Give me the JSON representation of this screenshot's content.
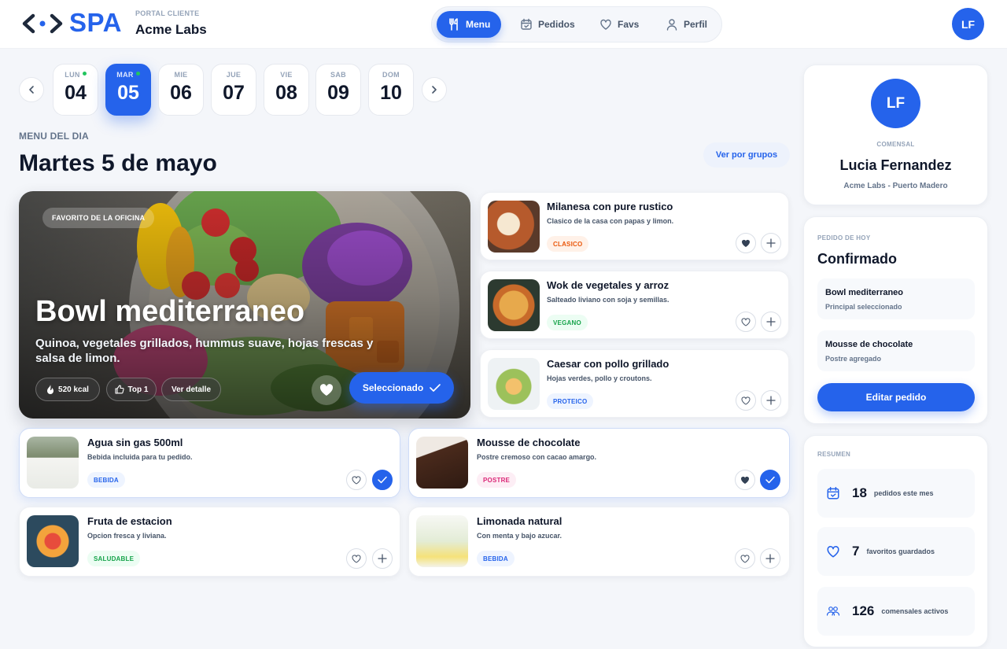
{
  "app": {
    "logo_text": "SPA",
    "portal_label": "PORTAL CLIENTE",
    "company": "Acme Labs",
    "user_initials": "LF"
  },
  "nav": [
    {
      "label": "Menu",
      "icon": "fork-knife-icon",
      "active": true
    },
    {
      "label": "Pedidos",
      "icon": "calendar-check-icon",
      "active": false
    },
    {
      "label": "Favs",
      "icon": "heart-icon",
      "active": false
    },
    {
      "label": "Perfil",
      "icon": "user-icon",
      "active": false
    }
  ],
  "days": [
    {
      "name": "LUN",
      "num": "04",
      "dot": true,
      "selected": false
    },
    {
      "name": "MAR",
      "num": "05",
      "dot": true,
      "selected": true
    },
    {
      "name": "MIE",
      "num": "06",
      "dot": false,
      "selected": false
    },
    {
      "name": "JUE",
      "num": "07",
      "dot": false,
      "selected": false
    },
    {
      "name": "VIE",
      "num": "08",
      "dot": false,
      "selected": false
    },
    {
      "name": "SAB",
      "num": "09",
      "dot": false,
      "selected": false
    },
    {
      "name": "DOM",
      "num": "10",
      "dot": false,
      "selected": false
    }
  ],
  "menu": {
    "section_label": "MENU DEL DIA",
    "title": "Martes 5 de mayo",
    "group_button": "Ver por grupos"
  },
  "hero": {
    "badge": "FAVORITO DE LA OFICINA",
    "title": "Bowl mediterraneo",
    "description": "Quinoa, vegetales grillados, hummus suave, hojas frescas y salsa de limon.",
    "kcal": "520 kcal",
    "rank": "Top 1",
    "detail": "Ver detalle",
    "selected_label": "Seleccionado"
  },
  "side_dishes": [
    {
      "name": "Milanesa con pure rustico",
      "desc": "Clasico de la casa con papas y limon.",
      "tag": "CLASICO",
      "tag_color": "orange",
      "fav": true
    },
    {
      "name": "Wok de vegetales y arroz",
      "desc": "Salteado liviano con soja y semillas.",
      "tag": "VEGANO",
      "tag_color": "green",
      "fav": false
    },
    {
      "name": "Caesar con pollo grillado",
      "desc": "Hojas verdes, pollo y croutons.",
      "tag": "PROTEICO",
      "tag_color": "blue",
      "fav": false
    }
  ],
  "extras": [
    {
      "name": "Agua sin gas 500ml",
      "desc": "Bebida incluida para tu pedido.",
      "tag": "BEBIDA",
      "tag_color": "blue",
      "fav": false,
      "selected": true
    },
    {
      "name": "Mousse de chocolate",
      "desc": "Postre cremoso con cacao amargo.",
      "tag": "POSTRE",
      "tag_color": "pink",
      "fav": true,
      "selected": true
    },
    {
      "name": "Fruta de estacion",
      "desc": "Opcion fresca y liviana.",
      "tag": "SALUDABLE",
      "tag_color": "green",
      "fav": false,
      "selected": false
    },
    {
      "name": "Limonada natural",
      "desc": "Con menta y bajo azucar.",
      "tag": "BEBIDA",
      "tag_color": "blue",
      "fav": false,
      "selected": false
    }
  ],
  "profile": {
    "initials": "LF",
    "role": "COMENSAL",
    "name": "Lucia Fernandez",
    "location": "Acme Labs - Puerto Madero"
  },
  "order": {
    "label": "PEDIDO DE HOY",
    "status": "Confirmado",
    "items": [
      {
        "title": "Bowl mediterraneo",
        "sub": "Principal seleccionado"
      },
      {
        "title": "Mousse de chocolate",
        "sub": "Postre agregado"
      }
    ],
    "edit_button": "Editar pedido"
  },
  "summary": {
    "label": "RESUMEN",
    "stats": [
      {
        "num": "18",
        "label": "pedidos este mes",
        "icon": "calendar-check-icon"
      },
      {
        "num": "7",
        "label": "favoritos guardados",
        "icon": "heart-icon"
      },
      {
        "num": "126",
        "label": "comensales activos",
        "icon": "users-icon"
      }
    ]
  },
  "colors": {
    "accent": "#2563eb",
    "bg": "#f4f6fa"
  }
}
